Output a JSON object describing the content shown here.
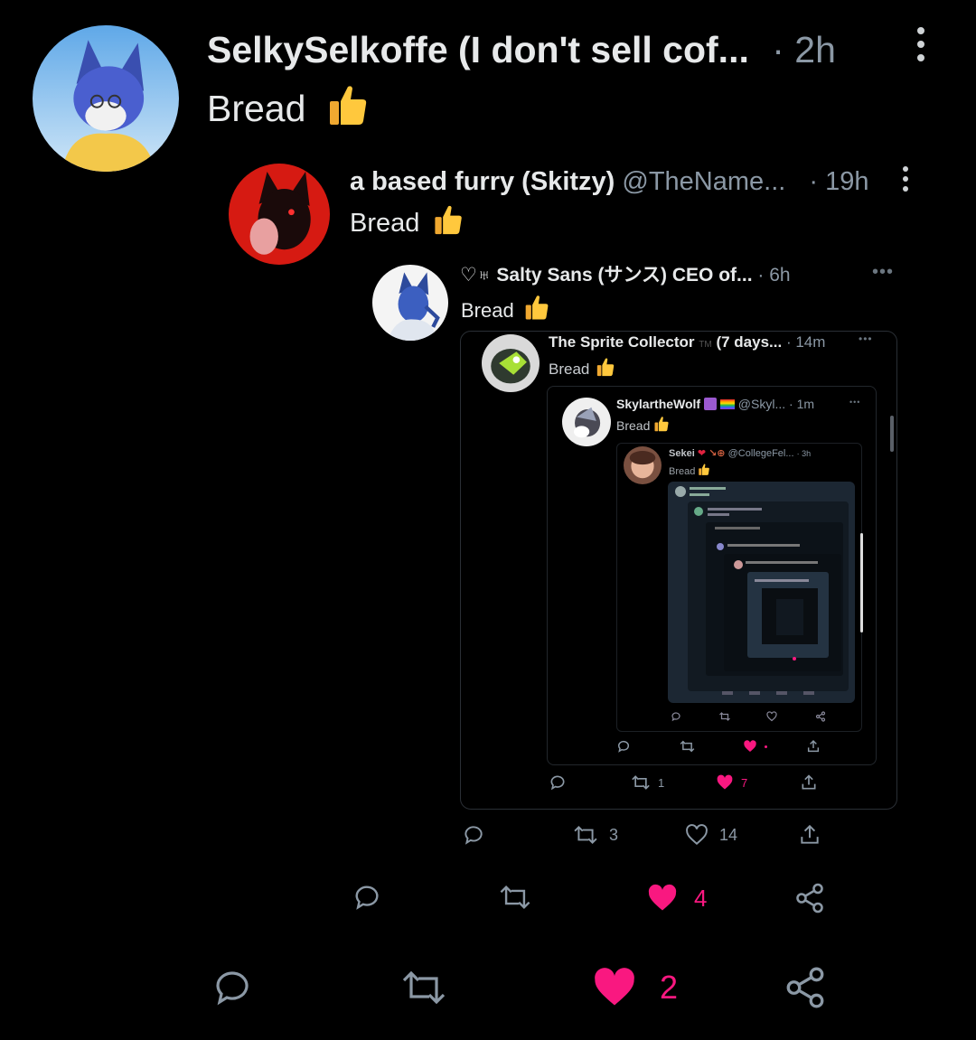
{
  "post1": {
    "name": "SelkySelkoffe (I don't sell cof...",
    "time": "· 2h",
    "text": "Bread",
    "emoji": "thumbs-up"
  },
  "post2": {
    "name": "a based furry (Skitzy)",
    "handle": "@TheName...",
    "time": "· 19h",
    "text": "Bread"
  },
  "post3": {
    "name": "♡♅ Salty Sans (サンス) CEO of...",
    "time": "· 6h",
    "text": "Bread"
  },
  "post4": {
    "name": "The Sprite Collector",
    "tm": "TM",
    "suffix": "(7 days...",
    "time": "· 14m",
    "text": "Bread"
  },
  "post5": {
    "name": "SkylartheWolf",
    "handle": "@Skyl...",
    "time": "· 1m",
    "text": "Bread"
  },
  "post6": {
    "name": "Sekei",
    "handle": "@CollegeFel...",
    "time": "· 3h",
    "text": "Bread"
  },
  "actions_inner": {
    "retweets": "1",
    "likes": "7"
  },
  "actions_post3": {
    "retweets": "3",
    "likes": "14"
  },
  "actions_post2": {
    "likes": "4"
  },
  "actions_post1": {
    "likes": "2"
  },
  "colors": {
    "like_pink": "#f91880",
    "text": "#e7e9ea",
    "muted": "#8b98a5",
    "bg": "#000000"
  }
}
